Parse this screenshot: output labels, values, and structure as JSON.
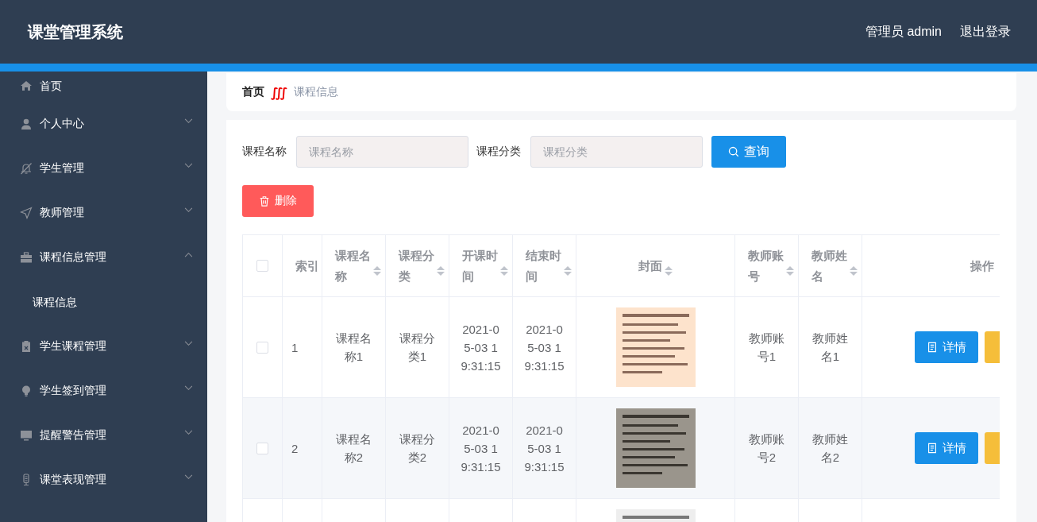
{
  "header": {
    "title": "课堂管理系统",
    "user": "管理员 admin",
    "logout": "退出登录"
  },
  "sidebar": {
    "items": [
      {
        "label": "首页",
        "kind": "link"
      },
      {
        "label": "个人中心",
        "kind": "group",
        "expanded": false
      },
      {
        "label": "学生管理",
        "kind": "group",
        "expanded": false
      },
      {
        "label": "教师管理",
        "kind": "group",
        "expanded": false
      },
      {
        "label": "课程信息管理",
        "kind": "group",
        "expanded": true,
        "children": [
          {
            "label": "课程信息"
          }
        ]
      },
      {
        "label": "学生课程管理",
        "kind": "group",
        "expanded": false
      },
      {
        "label": "学生签到管理",
        "kind": "group",
        "expanded": false
      },
      {
        "label": "提醒警告管理",
        "kind": "group",
        "expanded": false
      },
      {
        "label": "课堂表现管理",
        "kind": "group",
        "expanded": false
      }
    ]
  },
  "breadcrumb": {
    "home": "首页",
    "separator": "∭",
    "current": "课程信息"
  },
  "search": {
    "fields": [
      {
        "label": "课程名称",
        "placeholder": "课程名称"
      },
      {
        "label": "课程分类",
        "placeholder": "课程分类"
      }
    ],
    "button": "查询"
  },
  "delete_button": "删除",
  "table": {
    "select_all": {
      "checked": false
    },
    "columns": [
      {
        "label": "索引",
        "sortable": false
      },
      {
        "label": "课程名称",
        "sortable": true
      },
      {
        "label": "课程分类",
        "sortable": true
      },
      {
        "label": "开课时间",
        "sortable": true
      },
      {
        "label": "结束时间",
        "sortable": true
      },
      {
        "label": "封面",
        "sortable": true
      },
      {
        "label": "教师账号",
        "sortable": true
      },
      {
        "label": "教师姓名",
        "sortable": true
      },
      {
        "label": "操作",
        "sortable": false
      }
    ],
    "rows": [
      {
        "checked": false,
        "cells": [
          "1",
          "课程名称1",
          "课程分类1",
          "2021-05-03 19:31:15",
          "2021-05-03 19:31:15"
        ],
        "cover": {
          "kind": "picture"
        },
        "teacher": [
          "教师账号1",
          "教师姓名1"
        ],
        "actions": [
          {
            "kind": "detail",
            "label": "详情"
          },
          {
            "kind": "warning"
          }
        ]
      },
      {
        "checked": false,
        "cells": [
          "2",
          "课程名称2",
          "课程分类2",
          "2021-05-03 19:31:15",
          "2021-05-03 19:31:15"
        ],
        "cover": {
          "kind": "picture"
        },
        "teacher": [
          "教师账号2",
          "教师姓名2"
        ],
        "actions": [
          {
            "kind": "detail",
            "label": "详情"
          },
          {
            "kind": "warning"
          }
        ]
      },
      {
        "cover": {
          "kind": "picture"
        }
      }
    ]
  }
}
